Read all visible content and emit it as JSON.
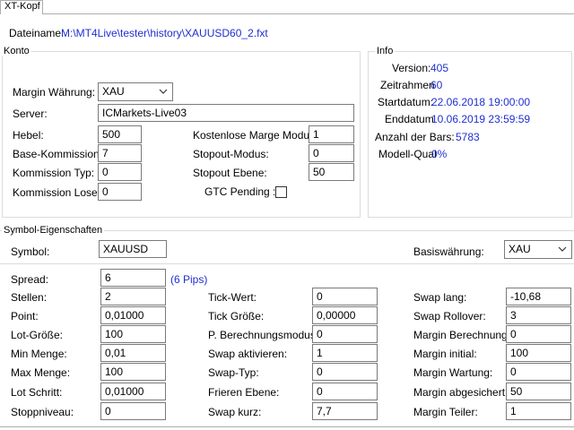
{
  "tab": {
    "label": "XT-Kopf"
  },
  "file": {
    "label": "Dateiname:",
    "path": "M:\\MT4Live\\tester\\history\\XAUUSD60_2.fxt"
  },
  "konto": {
    "title": "Konto",
    "margin_currency_label": "Margin Währung:",
    "margin_currency": "XAU",
    "server_label": "Server:",
    "server": "ICMarkets-Live03",
    "hebel_label": "Hebel:",
    "hebel": "500",
    "base_comm_label": "Base-Kommission:",
    "base_comm": "7",
    "comm_type_label": "Kommission Typ:",
    "comm_type": "0",
    "comm_lots_label": "Kommission Lose:",
    "comm_lots": "0",
    "free_margin_label": "Kostenlose Marge Modus:",
    "free_margin": "1",
    "stopout_mode_label": "Stopout-Modus:",
    "stopout_mode": "0",
    "stopout_level_label": "Stopout Ebene:",
    "stopout_level": "50",
    "gtc_label": "GTC Pending :",
    "gtc_checked": false
  },
  "info": {
    "title": "Info",
    "version_label": "Version:",
    "version": "405",
    "timeframe_label": "Zeitrahmen",
    "timeframe": "60",
    "start_label": "Startdatum:",
    "start": "22.06.2018 19:00:00",
    "end_label": "Enddatum",
    "end": "10.06.2019 23:59:59",
    "bars_label": "Anzahl der Bars:",
    "bars": "5783",
    "quality_label": "Modell-Qual",
    "quality": "0%"
  },
  "symbol": {
    "title": "Symbol-Eigenschaften",
    "symbol_label": "Symbol:",
    "symbol": "XAUUSD",
    "base_currency_label": "Basiswährung:",
    "base_currency": "XAU",
    "spread_label": "Spread:",
    "spread": "6",
    "spread_pips": "(6 Pips)",
    "col1": [
      {
        "label": "Stellen:",
        "value": "2"
      },
      {
        "label": "Point:",
        "value": "0,01000"
      },
      {
        "label": "Lot-Größe:",
        "value": "100"
      },
      {
        "label": "Min Menge:",
        "value": "0,01"
      },
      {
        "label": "Max Menge:",
        "value": "100"
      },
      {
        "label": "Lot Schritt:",
        "value": "0,01000"
      },
      {
        "label": "Stoppniveau:",
        "value": "0"
      }
    ],
    "col2": [
      {
        "label": "Tick-Wert:",
        "value": "0"
      },
      {
        "label": "Tick Größe:",
        "value": "0,00000"
      },
      {
        "label": "P. Berechnungsmodus:",
        "value": "0"
      },
      {
        "label": "Swap aktivieren:",
        "value": "1"
      },
      {
        "label": "Swap-Typ:",
        "value": "0"
      },
      {
        "label": "Frieren Ebene:",
        "value": "0"
      },
      {
        "label": "Swap kurz:",
        "value": "7,7"
      }
    ],
    "col3": [
      {
        "label": "Swap lang:",
        "value": "-10,68"
      },
      {
        "label": "Swap Rollover:",
        "value": "3"
      },
      {
        "label": "Margin Berechnung:",
        "value": "0"
      },
      {
        "label": "Margin initial:",
        "value": "100"
      },
      {
        "label": "Margin Wartung:",
        "value": "0"
      },
      {
        "label": "Margin abgesichert:",
        "value": "50"
      },
      {
        "label": "Margin Teiler:",
        "value": "1"
      }
    ]
  }
}
